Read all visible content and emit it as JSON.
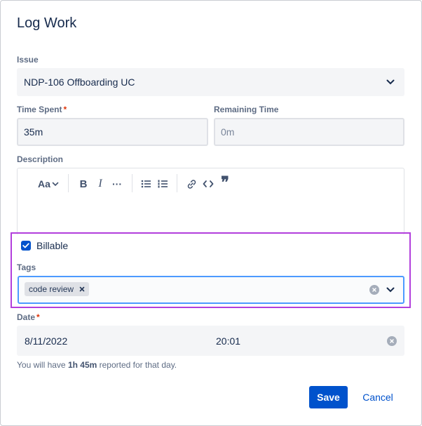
{
  "dialog": {
    "title": "Log Work"
  },
  "issue": {
    "label": "Issue",
    "value": "NDP-106 Offboarding UC"
  },
  "time_spent": {
    "label": "Time Spent",
    "required_mark": "*",
    "value": "35m"
  },
  "remaining_time": {
    "label": "Remaining Time",
    "placeholder": "0m"
  },
  "description": {
    "label": "Description",
    "toolbar": {
      "text_style": "Aa",
      "bold": "B",
      "italic": "I",
      "more": "···",
      "quote": "❞"
    }
  },
  "billable": {
    "label": "Billable",
    "checked": true
  },
  "tags": {
    "label": "Tags",
    "chips": [
      "code review"
    ]
  },
  "date": {
    "label": "Date",
    "required_mark": "*",
    "date_value": "8/11/2022",
    "time_value": "20:01"
  },
  "note": {
    "prefix": "You will have ",
    "amount": "1h 45m",
    "suffix": " reported for that day."
  },
  "actions": {
    "save": "Save",
    "cancel": "Cancel"
  },
  "colors": {
    "primary": "#0052cc",
    "highlight": "#b23fdc",
    "required": "#de350b"
  }
}
